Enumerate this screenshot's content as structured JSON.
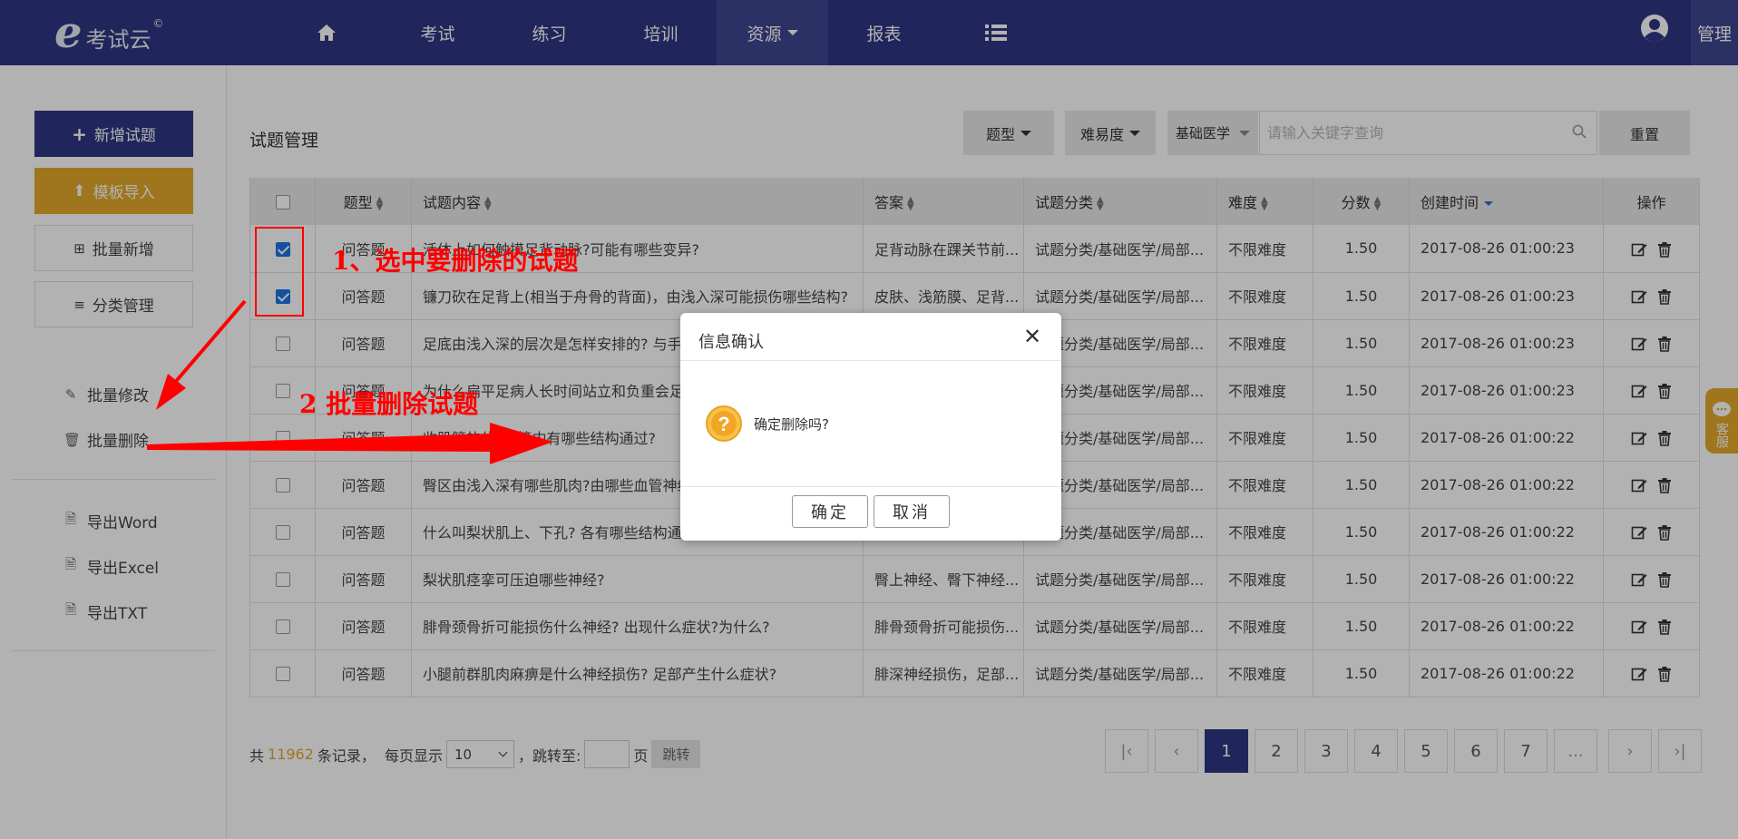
{
  "header": {
    "logo_text": "考试云",
    "logo_mark": "©",
    "nav": [
      {
        "label": "",
        "icon": "home-icon"
      },
      {
        "label": "考试"
      },
      {
        "label": "练习"
      },
      {
        "label": "培训"
      },
      {
        "label": "资源",
        "dropdown": true,
        "active": true
      },
      {
        "label": "报表"
      },
      {
        "label": "",
        "icon": "list-icon"
      }
    ],
    "manage_label": "管理"
  },
  "sidebar": {
    "new_question": "新增试题",
    "template_import": "模板导入",
    "batch_add": "批量新增",
    "category_manage": "分类管理",
    "batch_edit": "批量修改",
    "batch_delete": "批量删除",
    "export_word": "导出Word",
    "export_excel": "导出Excel",
    "export_txt": "导出TXT"
  },
  "main": {
    "title": "试题管理",
    "filters": {
      "type": "题型",
      "difficulty": "难易度",
      "category": "基础医学",
      "search_placeholder": "请输入关键字查询",
      "reset": "重置"
    }
  },
  "table": {
    "headers": {
      "type": "题型",
      "content": "试题内容",
      "answer": "答案",
      "category": "试题分类",
      "difficulty": "难度",
      "score": "分数",
      "created": "创建时间",
      "actions": "操作"
    },
    "rows": [
      {
        "checked": true,
        "type": "问答题",
        "content": "活体上如何触摸足背动脉?可能有哪些变异?",
        "answer": "足背动脉在踝关节前...",
        "category": "试题分类/基础医学/局部...",
        "difficulty": "不限难度",
        "score": "1.50",
        "created": "2017-08-26 01:00:23"
      },
      {
        "checked": true,
        "type": "问答题",
        "content": "镰刀砍在足背上(相当于舟骨的背面)，由浅入深可能损伤哪些结构?",
        "answer": "皮肤、浅筋膜、足背...",
        "category": "试题分类/基础医学/局部...",
        "difficulty": "不限难度",
        "score": "1.50",
        "created": "2017-08-26 01:00:23"
      },
      {
        "checked": false,
        "type": "问答题",
        "content": "足底由浅入深的层次是怎样安排的? 与手掌有何异同?",
        "answer": "",
        "category": "试题分类/基础医学/局部...",
        "difficulty": "不限难度",
        "score": "1.50",
        "created": "2017-08-26 01:00:23"
      },
      {
        "checked": false,
        "type": "问答题",
        "content": "为什么扁平足病人长时间站立和负重会足底疼痛?",
        "answer": "",
        "category": "试题分类/基础医学/局部...",
        "difficulty": "不限难度",
        "score": "1.50",
        "created": "2017-08-26 01:00:23"
      },
      {
        "checked": false,
        "type": "问答题",
        "content": "收肌管的位置?管内有哪些结构通过?",
        "answer": "",
        "category": "试题分类/基础医学/局部...",
        "difficulty": "不限难度",
        "score": "1.50",
        "created": "2017-08-26 01:00:22"
      },
      {
        "checked": false,
        "type": "问答题",
        "content": "臀区由浅入深有哪些肌肉?由哪些血管神经支配?",
        "answer": "",
        "category": "试题分类/基础医学/局部...",
        "difficulty": "不限难度",
        "score": "1.50",
        "created": "2017-08-26 01:00:22"
      },
      {
        "checked": false,
        "type": "问答题",
        "content": "什么叫梨状肌上、下孔? 各有哪些结构通过?",
        "answer": "",
        "category": "试题分类/基础医学/局部...",
        "difficulty": "不限难度",
        "score": "1.50",
        "created": "2017-08-26 01:00:22"
      },
      {
        "checked": false,
        "type": "问答题",
        "content": "梨状肌痉挛可压迫哪些神经?",
        "answer": "臀上神经、臀下神经...",
        "category": "试题分类/基础医学/局部...",
        "difficulty": "不限难度",
        "score": "1.50",
        "created": "2017-08-26 01:00:22"
      },
      {
        "checked": false,
        "type": "问答题",
        "content": "腓骨颈骨折可能损伤什么神经? 出现什么症状?为什么?",
        "answer": "腓骨颈骨折可能损伤...",
        "category": "试题分类/基础医学/局部...",
        "difficulty": "不限难度",
        "score": "1.50",
        "created": "2017-08-26 01:00:22"
      },
      {
        "checked": false,
        "type": "问答题",
        "content": "小腿前群肌肉麻痹是什么神经损伤? 足部产生什么症状?",
        "answer": "腓深神经损伤，足部...",
        "category": "试题分类/基础医学/局部...",
        "difficulty": "不限难度",
        "score": "1.50",
        "created": "2017-08-26 01:00:22"
      }
    ]
  },
  "pager": {
    "total_prefix": "共",
    "total": "11962",
    "total_suffix": "条记录，",
    "per_page_label": "每页显示",
    "per_page": "10",
    "jump_label": "，跳转至:",
    "page_unit": "页",
    "jump_btn": "跳转",
    "pages": [
      "1",
      "2",
      "3",
      "4",
      "5",
      "6",
      "7",
      "..."
    ],
    "current": "1"
  },
  "cs_tab": {
    "label": "客服"
  },
  "dialog": {
    "title": "信息确认",
    "message": "确定删除吗?",
    "ok": "确定",
    "cancel": "取消"
  },
  "annotations": {
    "step1": "1、选中要删除的试题",
    "step2": "2  批量删除试题"
  },
  "colors": {
    "brand": "#2e3683",
    "accent": "#e4a92c",
    "annotation": "#ff0000",
    "checkbox": "#1a73e8"
  }
}
